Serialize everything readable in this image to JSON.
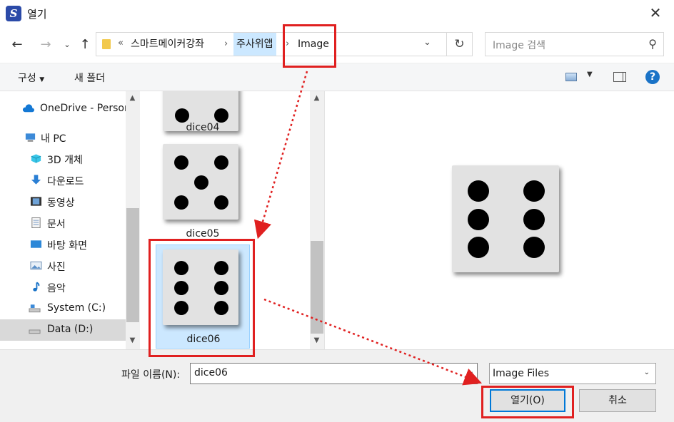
{
  "window": {
    "title": "열기",
    "app_icon_letter": "S"
  },
  "nav": {
    "breadcrumb_overflow": "«",
    "breadcrumb": [
      "스마트메이커강좌",
      "주사위앱",
      "Image"
    ],
    "search_placeholder": "Image 검색"
  },
  "toolbar": {
    "organize": "구성",
    "new_folder": "새 폴더",
    "help": "?"
  },
  "sidebar": {
    "items": [
      {
        "label": "OneDrive - Person",
        "icon": "cloud-icon"
      },
      {
        "label": "내 PC",
        "icon": "pc-icon"
      },
      {
        "label": "3D 개체",
        "icon": "cube-icon"
      },
      {
        "label": "다운로드",
        "icon": "download-icon"
      },
      {
        "label": "동영상",
        "icon": "video-icon"
      },
      {
        "label": "문서",
        "icon": "document-icon"
      },
      {
        "label": "바탕 화면",
        "icon": "desktop-icon"
      },
      {
        "label": "사진",
        "icon": "picture-icon"
      },
      {
        "label": "음악",
        "icon": "music-icon"
      },
      {
        "label": "System (C:)",
        "icon": "drive-icon"
      },
      {
        "label": "Data (D:)",
        "icon": "drive-icon"
      }
    ],
    "selected": "Data (D:)"
  },
  "files": [
    {
      "name": "dice04",
      "pips": 4
    },
    {
      "name": "dice05",
      "pips": 5
    },
    {
      "name": "dice06",
      "pips": 6,
      "selected": true
    }
  ],
  "preview": {
    "file": "dice06",
    "pips": 6
  },
  "bottom": {
    "filename_label": "파일 이름(N):",
    "filename_value": "dice06",
    "filetype_value": "Image Files",
    "open_button": "열기(O)",
    "cancel_button": "취소"
  },
  "colors": {
    "annotation": "#e02020",
    "selection": "#cce8ff",
    "accent": "#0078d7"
  }
}
